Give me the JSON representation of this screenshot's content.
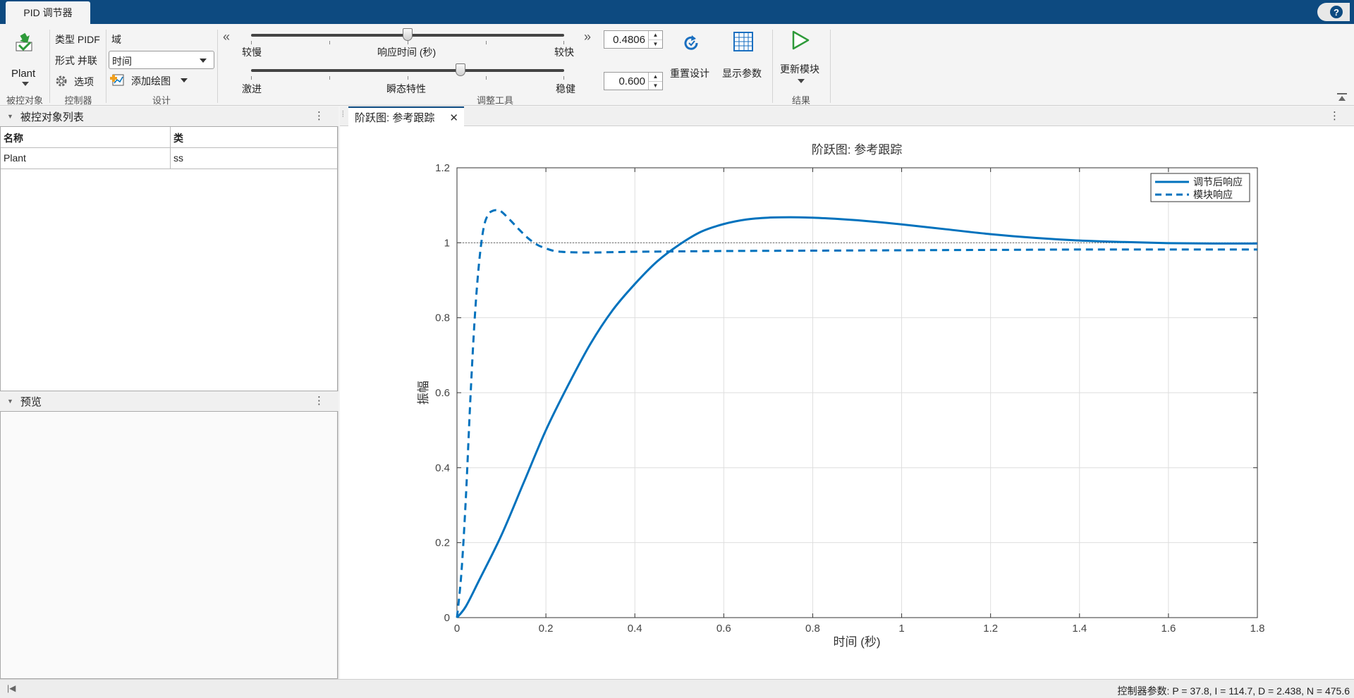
{
  "app_tab": "PID 调节器",
  "help_label": "?",
  "toolstrip": {
    "plant_button": "Plant",
    "plant_section": "被控对象",
    "type_label": "类型 PIDF",
    "form_label": "形式 并联",
    "options_label": "选项",
    "controller_section": "控制器",
    "domain_label": "域",
    "domain_value": "时间",
    "add_plot_label": "添加绘图",
    "design_section": "设计",
    "slider1_left": "较慢",
    "slider1_center": "响应时间 (秒)",
    "slider1_right": "较快",
    "slider1_value": "0.4806",
    "slider1_level": 0.5,
    "slider2_left": "激进",
    "slider2_center": "瞬态特性",
    "slider2_right": "稳健",
    "slider2_value": "0.600",
    "slider2_level": 0.67,
    "tuning_section": "调整工具",
    "reset_label": "重置设计",
    "show_params_label": "显示参数",
    "update_block_label": "更新模块",
    "results_section": "结果"
  },
  "left_panel": {
    "plant_list_title": "被控对象列表",
    "columns": [
      "名称",
      "类"
    ],
    "rows": [
      [
        "Plant",
        "ss"
      ]
    ],
    "preview_title": "预览"
  },
  "doc_tab": "阶跃图: 参考跟踪",
  "chart_data": {
    "type": "line",
    "title": "阶跃图: 参考跟踪",
    "xlabel": "时间 (秒)",
    "ylabel": "振幅",
    "xlim": [
      0,
      1.8
    ],
    "ylim": [
      0,
      1.2
    ],
    "xticks": [
      "0",
      "0.2",
      "0.4",
      "0.6",
      "0.8",
      "1",
      "1.2",
      "1.4",
      "1.6",
      "1.8"
    ],
    "yticks": [
      "0",
      "0.2",
      "0.4",
      "0.6",
      "0.8",
      "1",
      "1.2"
    ],
    "grid": true,
    "legend_position": "top-right",
    "reference_line": 1,
    "series": [
      {
        "name": "调节后响应",
        "style": "solid",
        "color": "#0072bd",
        "x": [
          0,
          0.02,
          0.05,
          0.1,
          0.15,
          0.2,
          0.25,
          0.3,
          0.35,
          0.4,
          0.45,
          0.5,
          0.55,
          0.6,
          0.65,
          0.7,
          0.75,
          0.8,
          0.85,
          0.9,
          0.95,
          1.0,
          1.1,
          1.2,
          1.3,
          1.4,
          1.5,
          1.6,
          1.7,
          1.8
        ],
        "y": [
          0,
          0.03,
          0.1,
          0.22,
          0.36,
          0.5,
          0.62,
          0.73,
          0.82,
          0.89,
          0.95,
          0.995,
          1.03,
          1.05,
          1.062,
          1.067,
          1.068,
          1.067,
          1.064,
          1.06,
          1.055,
          1.049,
          1.036,
          1.023,
          1.013,
          1.006,
          1.002,
          0.999,
          0.998,
          0.998
        ]
      },
      {
        "name": "模块响应",
        "style": "dashed",
        "color": "#0072bd",
        "x": [
          0,
          0.01,
          0.02,
          0.03,
          0.04,
          0.05,
          0.06,
          0.07,
          0.08,
          0.09,
          0.1,
          0.12,
          0.14,
          0.16,
          0.18,
          0.2,
          0.22,
          0.25,
          0.3,
          0.35,
          0.4,
          0.5,
          0.6,
          0.8,
          1.0,
          1.2,
          1.4,
          1.6,
          1.8
        ],
        "y": [
          0,
          0.12,
          0.32,
          0.58,
          0.8,
          0.95,
          1.04,
          1.075,
          1.085,
          1.087,
          1.083,
          1.06,
          1.035,
          1.012,
          0.995,
          0.985,
          0.978,
          0.975,
          0.974,
          0.975,
          0.976,
          0.977,
          0.978,
          0.979,
          0.98,
          0.981,
          0.982,
          0.982,
          0.982
        ]
      }
    ]
  },
  "status_bar": "控制器参数: P = 37.8, I = 114.7, D = 2.438, N = 475.6"
}
